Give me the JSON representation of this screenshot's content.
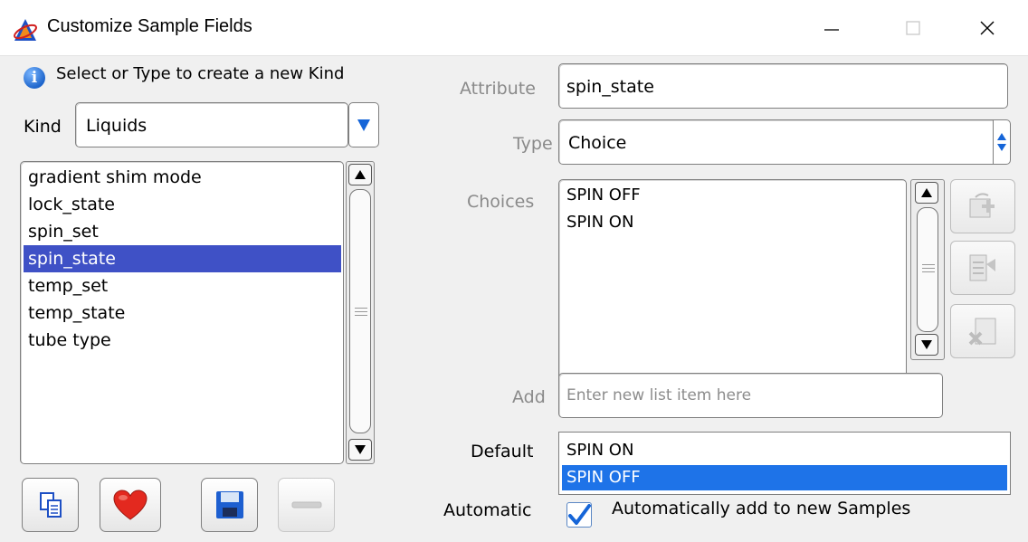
{
  "window": {
    "title": "Customize Sample Fields",
    "controls": {
      "minimize": "—",
      "maximize": "☐",
      "close": "✕"
    }
  },
  "left": {
    "info_text": "Select or Type to create a new Kind",
    "kind_label": "Kind",
    "kind_value": "Liquids",
    "kind_items": [
      "gradient shim mode",
      "lock_state",
      "spin_set",
      "spin_state",
      "temp_set",
      "temp_state",
      "tube type"
    ],
    "kind_selected": "spin_state",
    "buttons": [
      "copy-icon",
      "heart-icon",
      "save-icon",
      "minus-icon"
    ]
  },
  "right": {
    "attribute_label": "Attribute",
    "attribute_value": "spin_state",
    "type_label": "Type",
    "type_value": "Choice",
    "choices_label": "Choices",
    "choices": [
      "SPIN OFF",
      "SPIN ON"
    ],
    "side_buttons": [
      "add-choice-icon",
      "insert-choice-icon",
      "delete-choice-icon"
    ],
    "add_label": "Add",
    "add_placeholder": "Enter new list item here",
    "default_label": "Default",
    "default_options": [
      "SPIN ON",
      "SPIN OFF"
    ],
    "default_selected": "SPIN OFF",
    "automatic_label": "Automatic",
    "automatic_checked": true,
    "automatic_text": "Automatically add to new Samples"
  },
  "colors": {
    "list_selection": "#3f51c6",
    "default_selection": "#1e73e8",
    "heart": "#e3291f",
    "accent_blue": "#1565d8"
  }
}
